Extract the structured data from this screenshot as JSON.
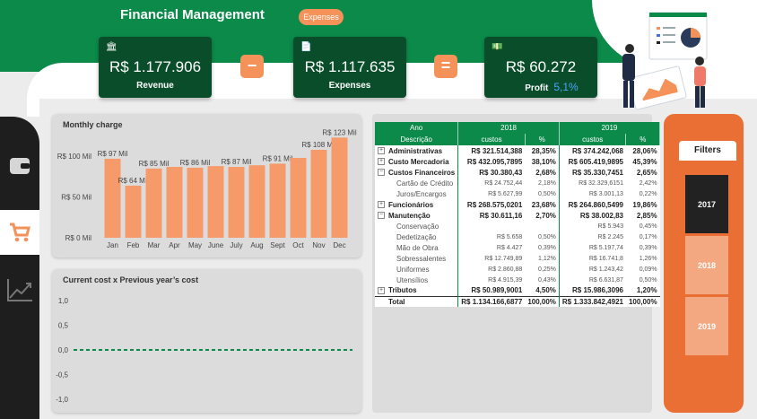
{
  "header": {
    "title": "Financial Management",
    "tag": "Expenses"
  },
  "kpis": [
    {
      "value": "R$ 1.177.906",
      "label": "Revenue",
      "icon": "money-icon"
    },
    {
      "value": "R$ 1.117.635",
      "label": "Expenses",
      "icon": "receipt-icon"
    },
    {
      "value": "R$ 60.272",
      "label": "Profit",
      "pct": "5,1%",
      "icon": "cash-icon"
    }
  ],
  "operators": {
    "minus": "−",
    "equals": "="
  },
  "monthly_panel": {
    "title": "Monthly charge"
  },
  "compare_panel": {
    "title": "Current cost x Previous year’s cost"
  },
  "filters": {
    "title": "Filters",
    "years": [
      "2017",
      "2018",
      "2019"
    ],
    "selected": "2017"
  },
  "colors": {
    "green": "#0b8a4a",
    "dark_green": "#0a4d2a",
    "orange": "#f4925a",
    "bar": "#f59a68",
    "dashed": "#0b8a4a"
  },
  "table": {
    "head1": [
      "Ano",
      "2018",
      "2019"
    ],
    "head2": [
      "Descrição",
      "custos",
      "%",
      "custos",
      "%"
    ],
    "rows": [
      {
        "type": "bold",
        "exp": "+",
        "name": "Administrativas",
        "c18": "R$ 321.514,388",
        "p18": "28,35%",
        "c19": "R$ 374.242,068",
        "p19": "28,06%"
      },
      {
        "type": "bold",
        "exp": "+",
        "name": "Custo Mercadoria",
        "c18": "R$ 432.095,7895",
        "p18": "38,10%",
        "c19": "R$ 605.419,9895",
        "p19": "45,39%"
      },
      {
        "type": "bold",
        "exp": "−",
        "name": "Custos Financeiros",
        "c18": "R$ 30.380,43",
        "p18": "2,68%",
        "c19": "R$ 35.330,7451",
        "p19": "2,65%"
      },
      {
        "type": "sub",
        "name": "Cartão de Crédito",
        "c18": "R$ 24.752,44",
        "p18": "2,18%",
        "c19": "R$ 32.329,6151",
        "p19": "2,42%"
      },
      {
        "type": "sub",
        "name": "Juros/Encargos",
        "c18": "R$ 5.627,99",
        "p18": "0,50%",
        "c19": "R$ 3.001,13",
        "p19": "0,22%"
      },
      {
        "type": "bold",
        "exp": "+",
        "name": "Funcionários",
        "c18": "R$ 268.575,0201",
        "p18": "23,68%",
        "c19": "R$ 264.860,5499",
        "p19": "19,86%"
      },
      {
        "type": "bold",
        "exp": "−",
        "name": "Manutenção",
        "c18": "R$ 30.611,16",
        "p18": "2,70%",
        "c19": "R$ 38.002,83",
        "p19": "2,85%"
      },
      {
        "type": "sub",
        "name": "Conservação",
        "c18": "",
        "p18": "",
        "c19": "R$ 5.943",
        "p19": "0,45%"
      },
      {
        "type": "sub",
        "name": "Dedetização",
        "c18": "R$ 5.658",
        "p18": "0,50%",
        "c19": "R$ 2.245",
        "p19": "0,17%"
      },
      {
        "type": "sub",
        "name": "Mão de Obra",
        "c18": "R$ 4.427",
        "p18": "0,39%",
        "c19": "R$ 5.197,74",
        "p19": "0,39%"
      },
      {
        "type": "sub",
        "name": "Sobressalentes",
        "c18": "R$ 12.749,89",
        "p18": "1,12%",
        "c19": "R$ 16.741,8",
        "p19": "1,26%"
      },
      {
        "type": "sub",
        "name": "Uniformes",
        "c18": "R$ 2.860,88",
        "p18": "0,25%",
        "c19": "R$ 1.243,42",
        "p19": "0,09%"
      },
      {
        "type": "sub",
        "name": "Utensílios",
        "c18": "R$ 4.915,39",
        "p18": "0,43%",
        "c19": "R$ 6.631,87",
        "p19": "0,50%"
      },
      {
        "type": "bold",
        "exp": "+",
        "name": "Tributos",
        "c18": "R$ 50.989,9001",
        "p18": "4,50%",
        "c19": "R$ 15.986,3096",
        "p19": "1,20%"
      },
      {
        "type": "total",
        "name": "Total",
        "c18": "R$ 1.134.166,6877",
        "p18": "100,00%",
        "c19": "R$ 1.333.842,4921",
        "p19": "100,00%"
      }
    ]
  },
  "chart_data": [
    {
      "type": "bar",
      "title": "Monthly charge",
      "categories": [
        "Jan",
        "Feb",
        "Mar",
        "Apr",
        "May",
        "June",
        "July",
        "Aug",
        "Sept",
        "Oct",
        "Nov",
        "Dec"
      ],
      "values": [
        97,
        64,
        85,
        87,
        86,
        88,
        87,
        89,
        91,
        98,
        108,
        123
      ],
      "data_labels": [
        "R$ 97 Mil",
        "R$ 64 Mil",
        "R$ 85 Mil",
        "",
        "R$ 86 Mil",
        "",
        "R$ 87 Mil",
        "",
        "R$ 91 Mil",
        "",
        "R$ 108 Mil",
        "R$ 123 Mil"
      ],
      "y_ticks": [
        0,
        50,
        100
      ],
      "y_tick_labels": [
        "R$ 0 Mil",
        "R$ 50 Mil",
        "R$ 100 Mil"
      ],
      "ylim": [
        0,
        130
      ]
    },
    {
      "type": "line",
      "title": "Current cost x Previous year’s cost",
      "y_ticks": [
        1.0,
        0.5,
        0.0,
        -0.5,
        -1.0
      ],
      "y_tick_labels": [
        "1,0",
        "0,5",
        "0,0",
        "-0,5",
        "-1,0"
      ],
      "ylim": [
        -1.2,
        1.2
      ],
      "series": [
        {
          "values": [
            0,
            0
          ]
        }
      ]
    }
  ]
}
